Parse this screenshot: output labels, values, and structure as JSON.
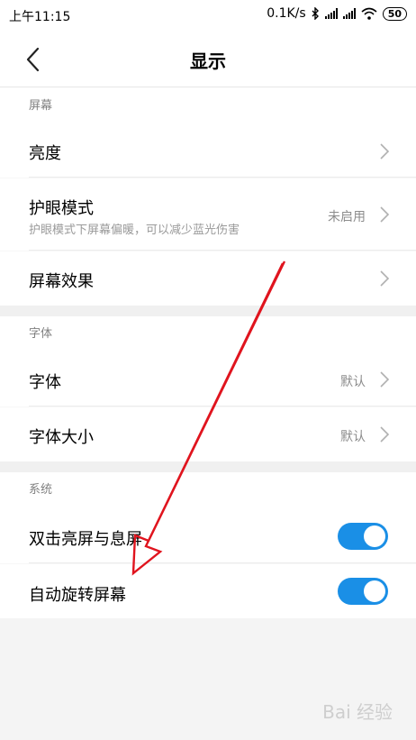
{
  "status_bar": {
    "time": "上午11:15",
    "network_speed": "0.1K/s",
    "battery": "50"
  },
  "header": {
    "title": "显示"
  },
  "sections": {
    "screen": {
      "title": "屏幕",
      "brightness": "亮度",
      "eye_mode": "护眼模式",
      "eye_mode_sub": "护眼模式下屏幕偏暖，可以减少蓝光伤害",
      "eye_mode_value": "未启用",
      "screen_effect": "屏幕效果"
    },
    "font": {
      "title": "字体",
      "font": "字体",
      "font_value": "默认",
      "font_size": "字体大小",
      "font_size_value": "默认"
    },
    "system": {
      "title": "系统",
      "double_tap": "双击亮屏与息屏",
      "double_tap_on": true,
      "auto_rotate": "自动旋转屏幕",
      "auto_rotate_on": true
    }
  },
  "colors": {
    "toggle_on": "#1a8fe6",
    "annotation_arrow": "#e0141e"
  },
  "icons": [
    "back-arrow-icon",
    "chevron-right-icon",
    "bluetooth-icon",
    "signal-icon",
    "wifi-icon",
    "battery-icon"
  ],
  "watermark": "Bai 经验"
}
